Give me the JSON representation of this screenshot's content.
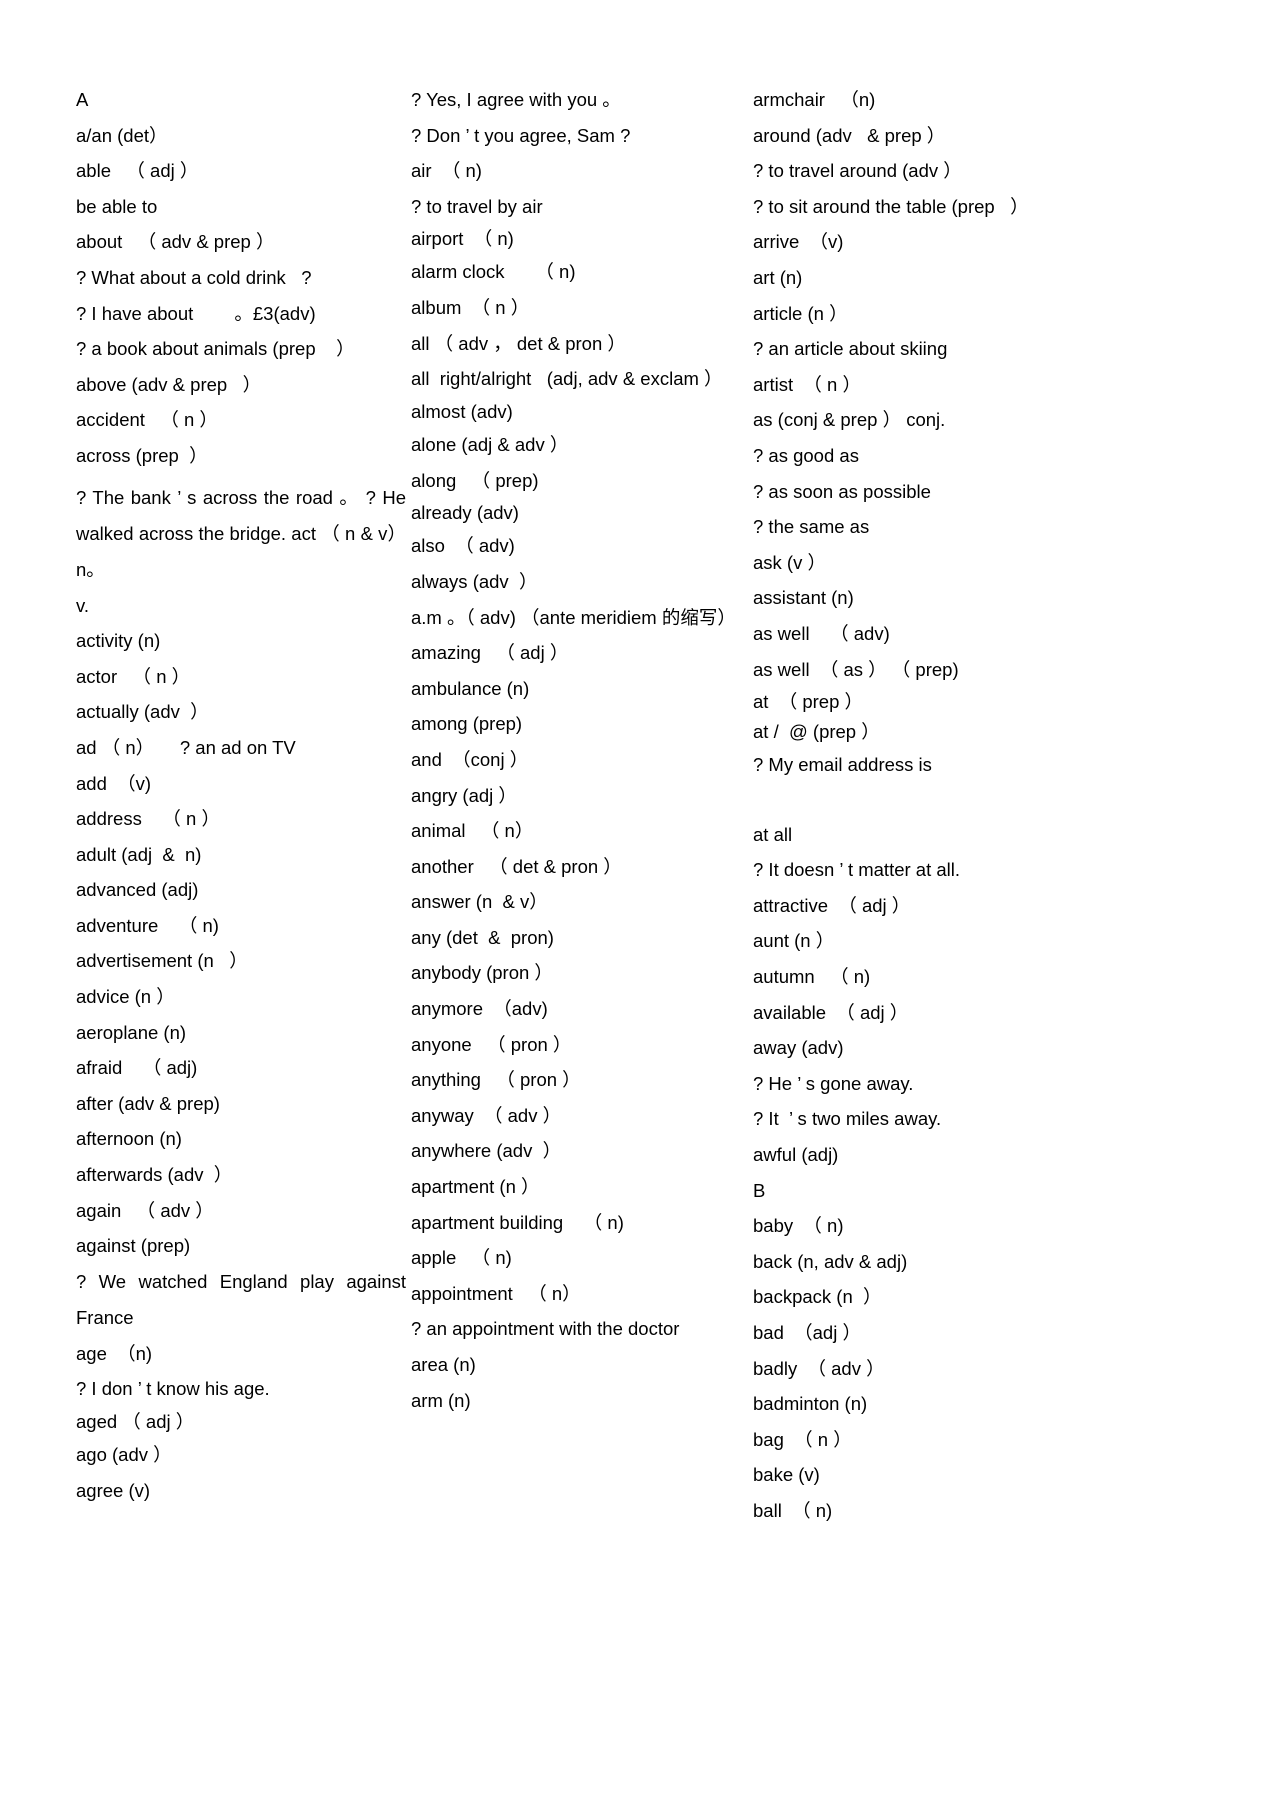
{
  "document": {
    "type": "vocabulary-word-list",
    "language": "English-Chinese",
    "page_background": "#ffffff",
    "text_color": "#000000"
  },
  "columns": [
    {
      "id": "column-1",
      "entries": [
        {
          "text": "A"
        },
        {
          "text": "a/an (det）"
        },
        {
          "text": "able   （ adj ）"
        },
        {
          "text": "be able to"
        },
        {
          "text": "about   （ adv & prep ）"
        },
        {
          "text": "? What about a cold drink   ?"
        },
        {
          "text": "? I have about        。£3(adv)"
        },
        {
          "text": "? a book about animals (prep    ）"
        },
        {
          "text": "above (adv & prep   ）"
        },
        {
          "text": "accident   （ n ）"
        },
        {
          "text": "across (prep  ）"
        },
        {
          "text": "? The bank ’ s across the road 。 ? He walked across the bridge. act （ n & v） n。"
        },
        {
          "text": "v."
        },
        {
          "text": "activity (n)"
        },
        {
          "text": "actor   （ n ）"
        },
        {
          "text": "actually (adv  ）"
        },
        {
          "text": "ad （ n）     ? an ad on TV"
        },
        {
          "text": "add  （v)"
        },
        {
          "text": "address    （ n ）"
        },
        {
          "text": "adult (adj  &  n)"
        },
        {
          "text": "advanced (adj)"
        },
        {
          "text": "adventure    （ n)"
        },
        {
          "text": "advertisement (n   ）"
        },
        {
          "text": "advice (n ）"
        },
        {
          "text": "aeroplane (n)"
        },
        {
          "text": "afraid    （ adj)"
        },
        {
          "text": "after (adv & prep)"
        },
        {
          "text": "afternoon (n)"
        },
        {
          "text": "afterwards (adv  ）"
        },
        {
          "text": "again   （ adv ）"
        },
        {
          "text": "against (prep)"
        },
        {
          "text": "? We watched England play against France"
        },
        {
          "text": "age  （n)"
        },
        {
          "text": "? I don ’ t know his age."
        },
        {
          "text": "aged （ adj ）"
        },
        {
          "text": "ago (adv ）"
        },
        {
          "text": "agree (v)"
        }
      ]
    },
    {
      "id": "column-2",
      "entries": [
        {
          "text": "? Yes, I agree with you 。"
        },
        {
          "text": "? Don ’ t you agree, Sam ?"
        },
        {
          "text": "air  （ n)"
        },
        {
          "text": "? to travel by air"
        },
        {
          "text": "airport  （ n)"
        },
        {
          "text": "alarm clock      （ n)"
        },
        {
          "text": "album  （ n ）"
        },
        {
          "text": "all （ adv ， det & pron ）"
        },
        {
          "text": "all  right/alright   (adj, adv & exclam ）"
        },
        {
          "text": "almost (adv)"
        },
        {
          "text": "alone (adj & adv ）"
        },
        {
          "text": "along   （ prep)"
        },
        {
          "text": "already (adv)"
        },
        {
          "text": "also  （ adv)"
        },
        {
          "text": "always (adv  ）"
        },
        {
          "text": "a.m 。（ adv) （ante meridiem 的缩写）"
        },
        {
          "text": "amazing   （ adj ）"
        },
        {
          "text": "ambulance (n)"
        },
        {
          "text": "among (prep)"
        },
        {
          "text": "and  （conj ）"
        },
        {
          "text": "angry (adj ）"
        },
        {
          "text": "animal   （ n）"
        },
        {
          "text": "another   （ det & pron ）"
        },
        {
          "text": "answer (n  & v）"
        },
        {
          "text": "any (det  &  pron)"
        },
        {
          "text": "anybody (pron ）"
        },
        {
          "text": "anymore  （adv)"
        },
        {
          "text": "anyone   （ pron ）"
        },
        {
          "text": "anything   （ pron ）"
        },
        {
          "text": "anyway  （ adv ）"
        },
        {
          "text": "anywhere (adv  ）"
        },
        {
          "text": "apartment (n ）"
        },
        {
          "text": "apartment building    （ n)"
        },
        {
          "text": "apple   （ n)"
        },
        {
          "text": "appointment   （ n）"
        },
        {
          "text": "? an appointment with the doctor"
        },
        {
          "text": "area (n)"
        },
        {
          "text": "arm (n)"
        }
      ]
    },
    {
      "id": "column-3",
      "entries": [
        {
          "text": "armchair   （n)"
        },
        {
          "text": "around (adv   & prep ）"
        },
        {
          "text": "? to travel around (adv ）"
        },
        {
          "text": "? to sit around the table (prep   ）"
        },
        {
          "text": "arrive  （v)"
        },
        {
          "text": "art (n)"
        },
        {
          "text": "article (n ）"
        },
        {
          "text": "? an article about skiing"
        },
        {
          "text": "artist  （ n ）"
        },
        {
          "text": "as (conj & prep ） conj."
        },
        {
          "text": "? as good as"
        },
        {
          "text": "? as soon as possible"
        },
        {
          "text": "? the same as"
        },
        {
          "text": "ask (v ）"
        },
        {
          "text": "assistant (n)"
        },
        {
          "text": "as well    （ adv)"
        },
        {
          "text": "as well  （ as ） （ prep)"
        },
        {
          "text": "at  （ prep ）"
        },
        {
          "text": "at /  @ (prep ）"
        },
        {
          "text": "? My email address is"
        },
        {
          "text": ""
        },
        {
          "text": "at all"
        },
        {
          "text": "? It doesn ’ t matter at all."
        },
        {
          "text": "attractive  （ adj ）"
        },
        {
          "text": "aunt (n ）"
        },
        {
          "text": "autumn   （ n)"
        },
        {
          "text": "available  （ adj ）"
        },
        {
          "text": "away (adv)"
        },
        {
          "text": "? He ’ s gone away."
        },
        {
          "text": "? It  ’ s two miles away."
        },
        {
          "text": "awful (adj)"
        },
        {
          "text": "B"
        },
        {
          "text": "baby  （ n)"
        },
        {
          "text": "back (n, adv & adj)"
        },
        {
          "text": "backpack (n  ）"
        },
        {
          "text": "bad  （adj ）"
        },
        {
          "text": "badly  （ adv ）"
        },
        {
          "text": "badminton (n)"
        },
        {
          "text": "bag  （ n ）"
        },
        {
          "text": "bake (v)"
        },
        {
          "text": "ball  （ n)"
        }
      ]
    }
  ]
}
